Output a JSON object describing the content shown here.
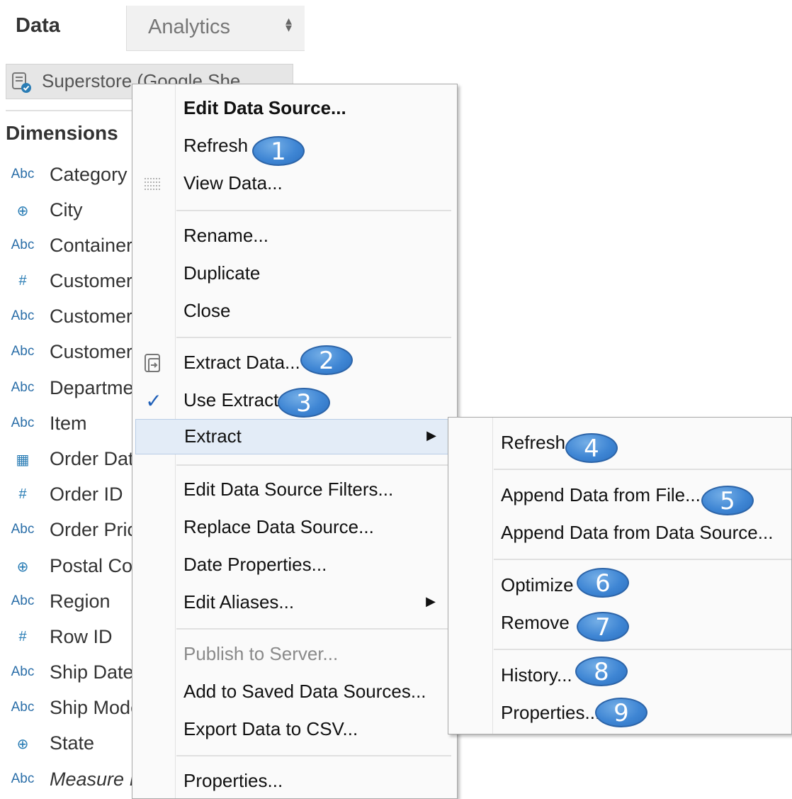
{
  "tabs": {
    "data": "Data",
    "analytics": "Analytics"
  },
  "data_source": {
    "name": "Superstore (Google She"
  },
  "dimensions": {
    "title": "Dimensions",
    "fields": [
      {
        "icon": "abc",
        "icon_text": "Abc",
        "name": "Category"
      },
      {
        "icon": "globe",
        "icon_text": "⊕",
        "name": "City"
      },
      {
        "icon": "abc",
        "icon_text": "Abc",
        "name": "Container"
      },
      {
        "icon": "hash",
        "icon_text": "#",
        "name": "Customer"
      },
      {
        "icon": "abc",
        "icon_text": "Abc",
        "name": "Customer"
      },
      {
        "icon": "abc",
        "icon_text": "Abc",
        "name": "Customer"
      },
      {
        "icon": "abc",
        "icon_text": "Abc",
        "name": "Departme"
      },
      {
        "icon": "abc",
        "icon_text": "Abc",
        "name": "Item"
      },
      {
        "icon": "calendar",
        "icon_text": "▦",
        "name": "Order Dat"
      },
      {
        "icon": "hash",
        "icon_text": "#",
        "name": "Order ID"
      },
      {
        "icon": "abc",
        "icon_text": "Abc",
        "name": "Order Pric"
      },
      {
        "icon": "globe",
        "icon_text": "⊕",
        "name": "Postal Co"
      },
      {
        "icon": "abc",
        "icon_text": "Abc",
        "name": "Region"
      },
      {
        "icon": "hash",
        "icon_text": "#",
        "name": "Row ID"
      },
      {
        "icon": "abc",
        "icon_text": "Abc",
        "name": "Ship Date"
      },
      {
        "icon": "abc",
        "icon_text": "Abc",
        "name": "Ship Mode"
      },
      {
        "icon": "globe",
        "icon_text": "⊕",
        "name": "State"
      },
      {
        "icon": "abc",
        "icon_text": "Abc",
        "name": "Measure I"
      }
    ]
  },
  "context_menu": {
    "edit_data_source": "Edit Data Source...",
    "refresh": "Refresh",
    "view_data": "View Data...",
    "rename": "Rename...",
    "duplicate": "Duplicate",
    "close": "Close",
    "extract_data": "Extract Data...",
    "use_extract": "Use Extract",
    "use_extract_check": "✓",
    "extract": "Extract",
    "edit_filters": "Edit Data Source Filters...",
    "replace_source": "Replace Data Source...",
    "date_properties": "Date Properties...",
    "edit_aliases": "Edit Aliases...",
    "publish": "Publish to Server...",
    "add_saved": "Add to Saved Data Sources...",
    "export_csv": "Export Data to CSV...",
    "properties": "Properties...",
    "submenu_arrow": "▶"
  },
  "extract_submenu": {
    "refresh": "Refresh",
    "append_file": "Append Data from File...",
    "append_source": "Append Data from Data Source...",
    "optimize": "Optimize",
    "remove": "Remove",
    "history": "History...",
    "properties": "Properties..."
  },
  "callouts": [
    "1",
    "2",
    "3",
    "4",
    "5",
    "6",
    "7",
    "8",
    "9"
  ],
  "colors": {
    "callout": "#3f86d4",
    "highlight": "#e3ecf7",
    "field_icon": "#2a7db5",
    "check": "#1f5fb8"
  }
}
